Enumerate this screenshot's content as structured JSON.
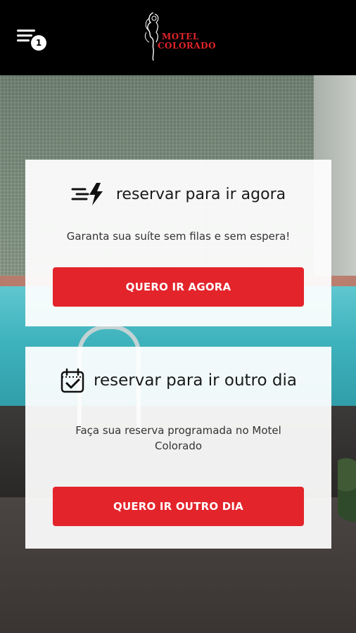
{
  "header": {
    "brand_line1": "MOTEL",
    "brand_line2": "COLORADO",
    "menu_badge": "1",
    "menu_icon": "hamburger-menu-icon",
    "brand_color": "#e3242b"
  },
  "cards": [
    {
      "icon": "lightning-bolt-icon",
      "title": "reservar para ir agora",
      "description": "Garanta sua suíte sem filas e sem espera!",
      "button_label": "QUERO IR AGORA"
    },
    {
      "icon": "calendar-check-icon",
      "title": "reservar para ir outro dia",
      "description": "Faça sua reserva programada no Motel Colorado",
      "button_label": "QUERO IR OUTRO DIA"
    }
  ],
  "colors": {
    "accent": "#e3242b",
    "topbar": "#000000",
    "card_background": "#ffffff"
  }
}
